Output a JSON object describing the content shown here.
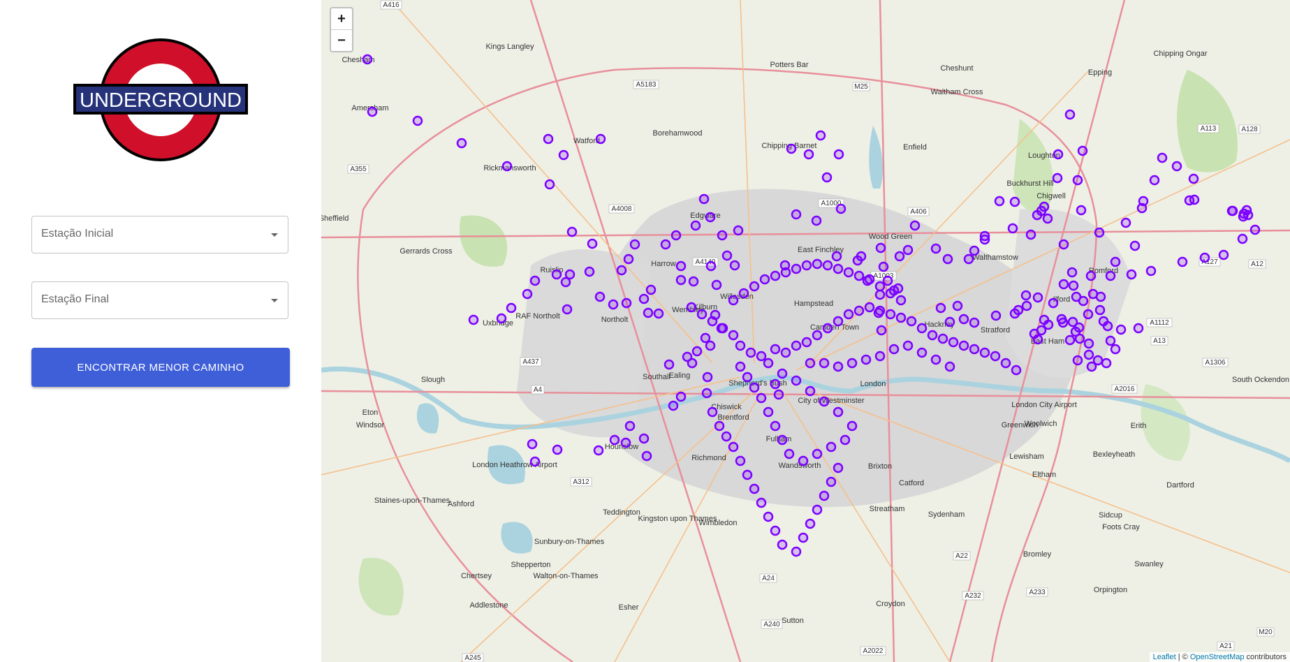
{
  "logo": {
    "text": "UNDERGROUND"
  },
  "form": {
    "start_label": "Estação Inicial",
    "end_label": "Estação Final",
    "button_label": "ENCONTRAR MENOR CAMINHO"
  },
  "map": {
    "zoom_in": "+",
    "zoom_out": "−",
    "attribution": {
      "leaflet": "Leaflet",
      "separator": " | © ",
      "osm": "OpenStreetMap",
      "suffix": " contributors"
    },
    "places": [
      "Chesham",
      "Amersham",
      "Kings Langley",
      "Watford",
      "Rickmansworth",
      "Borehamwood",
      "Potters Bar",
      "Cheshunt",
      "Waltham Cross",
      "Enfield",
      "Chipping Barnet",
      "Epping",
      "Chipping Ongar",
      "Loughton",
      "Chigwell",
      "Buckhurst Hill",
      "Edgware",
      "Harrow",
      "Ruislip",
      "Gerrards Cross",
      "Uxbridge",
      "Northolt",
      "RAF Northolt",
      "Wembley",
      "Willesden",
      "Kilburn",
      "Hampstead",
      "Camden Town",
      "East Finchley",
      "Wood Green",
      "Walthamstow",
      "Stratford",
      "Hackney",
      "Ilford",
      "Romford",
      "East Ham",
      "Slough",
      "Southall",
      "Ealing",
      "Brentford",
      "Chiswick",
      "Shepherd's Bush",
      "City of Westminster",
      "London",
      "Fulham",
      "Wandsworth",
      "Brixton",
      "Greenwich",
      "Lewisham",
      "Woolwich",
      "Eltham",
      "Catford",
      "Bexleyheath",
      "Erith",
      "Dartford",
      "Hounslow",
      "Richmond",
      "Windsor",
      "Eton",
      "Staines-upon-Thames",
      "Ashford",
      "Teddington",
      "Kingston upon Thames",
      "Sunbury-on-Thames",
      "Shepperton",
      "Walton-on-Thames",
      "Chertsey",
      "Addlestone",
      "Esher",
      "Wimbledon",
      "Streatham",
      "Sydenham",
      "Croydon",
      "Sutton",
      "Bromley",
      "Sidcup",
      "Foots Cray",
      "Swanley",
      "Orpington",
      "South Ockendon",
      "London Heathrow Airport",
      "London City Airport",
      "Sheffield"
    ],
    "roads": [
      "A416",
      "A5183",
      "M25",
      "A4008",
      "A406",
      "A4140",
      "A1000",
      "A1003",
      "A12",
      "A127",
      "A13",
      "A1306",
      "A2016",
      "A437",
      "A4",
      "A312",
      "A24",
      "A240",
      "A232",
      "A22",
      "A233",
      "A2022",
      "A21",
      "M20",
      "A245",
      "A355",
      "A113",
      "A128",
      "A1112"
    ],
    "station_marker_color": "#7b00ff",
    "station_count": 272
  }
}
